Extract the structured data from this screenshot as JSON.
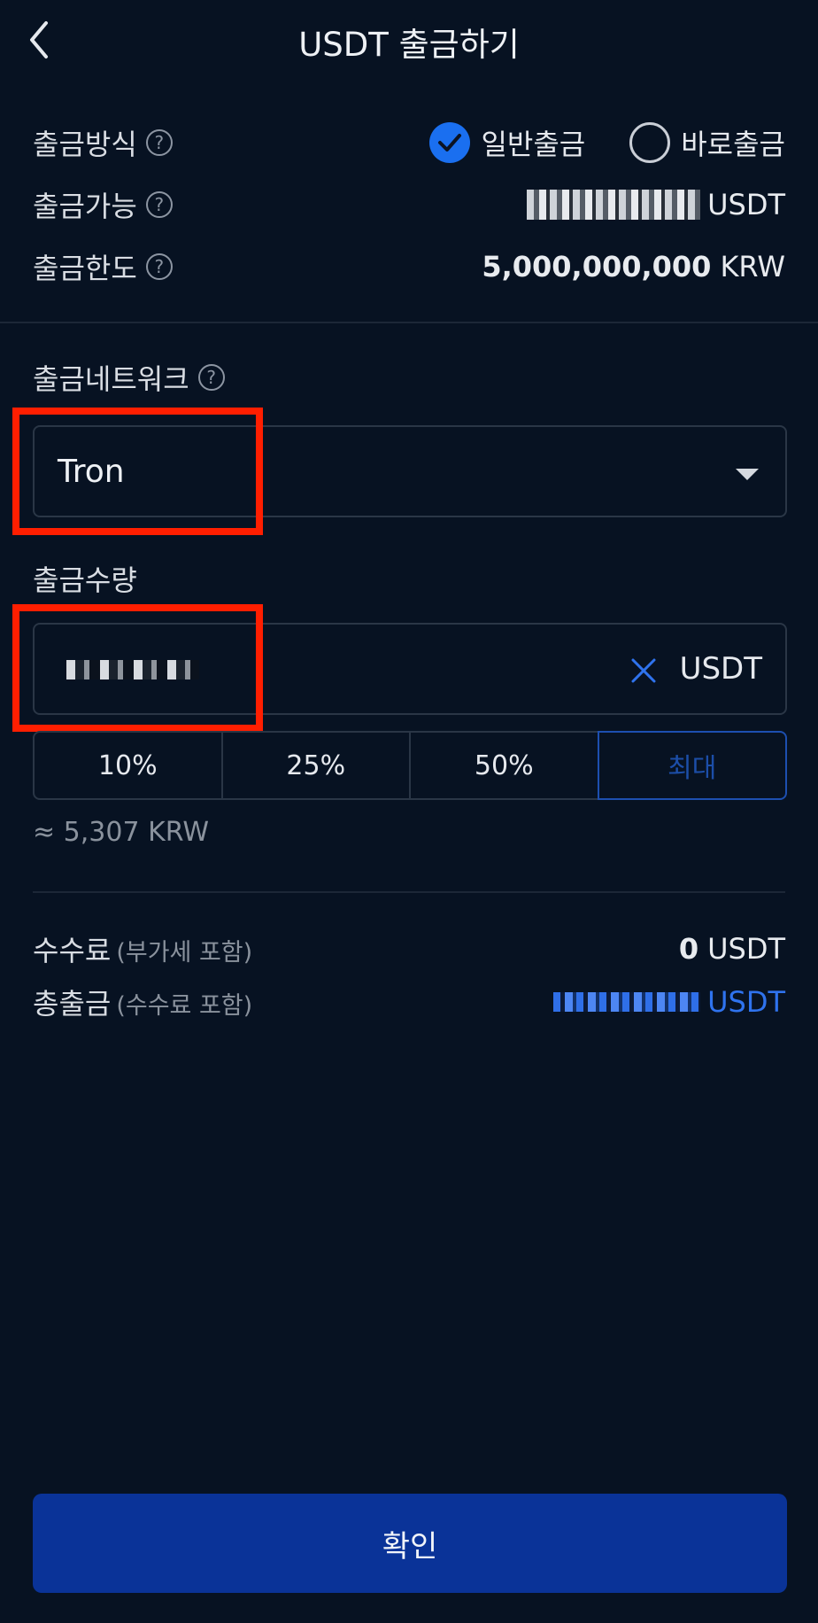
{
  "header": {
    "title": "USDT 출금하기",
    "back_icon": "chevron-left-icon"
  },
  "info": {
    "method_label": "출금방식",
    "method_options": [
      {
        "label": "일반출금",
        "selected": true
      },
      {
        "label": "바로출금",
        "selected": false
      }
    ],
    "available_label": "출금가능",
    "available_unit": "USDT",
    "limit_label": "출금한도",
    "limit_value": "5,000,000,000",
    "limit_unit": "KRW"
  },
  "network": {
    "label": "출금네트워크",
    "value": "Tron"
  },
  "amount": {
    "label": "출금수량",
    "unit": "USDT",
    "percent_buttons": [
      "10%",
      "25%",
      "50%",
      "최대"
    ],
    "approx": "≈ 5,307 KRW"
  },
  "summary": {
    "fee_label": "수수료",
    "fee_note": "(부가세 포함)",
    "fee_value": "0",
    "fee_unit": "USDT",
    "total_label": "총출금",
    "total_note": "(수수료 포함)",
    "total_unit": "USDT"
  },
  "confirm_label": "확인",
  "colors": {
    "background": "#071222",
    "accent": "#1a6ff0",
    "button": "#0a3398",
    "highlight": "#ff1e00"
  }
}
